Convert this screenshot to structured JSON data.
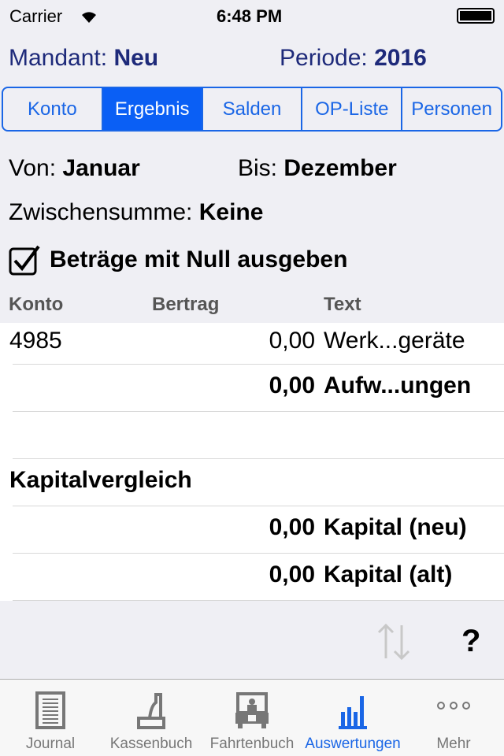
{
  "status": {
    "carrier": "Carrier",
    "time": "6:48 PM"
  },
  "header": {
    "mandant_label": "Mandant:",
    "mandant_value": "Neu",
    "periode_label": "Periode:",
    "periode_value": "2016"
  },
  "segments": [
    "Konto",
    "Ergebnis",
    "Salden",
    "OP-Liste",
    "Personen"
  ],
  "active_segment": "Ergebnis",
  "filters": {
    "von_label": "Von:",
    "von_value": "Januar",
    "bis_label": "Bis:",
    "bis_value": "Dezember",
    "zs_label": "Zwischensumme:",
    "zs_value": "Keine",
    "checkbox_label": "Beträge mit Null ausgeben",
    "checkbox_checked": true
  },
  "table": {
    "headers": [
      "Konto",
      "Bertrag",
      "Text"
    ],
    "rows": [
      {
        "konto": "4985",
        "betrag": "0,00",
        "text": "Werk...geräte",
        "bold": false
      },
      {
        "konto": "",
        "betrag": "0,00",
        "text": "Aufw...ungen",
        "bold": true
      },
      {
        "konto": "",
        "betrag": "",
        "text": "",
        "bold": false
      },
      {
        "konto": "Kapitalvergleich",
        "betrag": "",
        "text": "",
        "bold": true
      },
      {
        "konto": "",
        "betrag": "0,00",
        "text": "Kapital (neu)",
        "bold": true
      },
      {
        "konto": "",
        "betrag": "0,00",
        "text": "Kapital (alt)",
        "bold": true
      }
    ]
  },
  "toolbar": {
    "sort_icon": "sort-arrows-icon",
    "help_label": "?"
  },
  "tabs": [
    {
      "label": "Journal",
      "icon": "journal-icon"
    },
    {
      "label": "Kassenbuch",
      "icon": "cash-register-icon"
    },
    {
      "label": "Fahrtenbuch",
      "icon": "car-icon"
    },
    {
      "label": "Auswertungen",
      "icon": "bar-chart-icon",
      "active": true
    },
    {
      "label": "Mehr",
      "icon": "more-icon"
    }
  ],
  "colors": {
    "accent": "#0a5ff5",
    "header_text": "#1e2a7a"
  }
}
